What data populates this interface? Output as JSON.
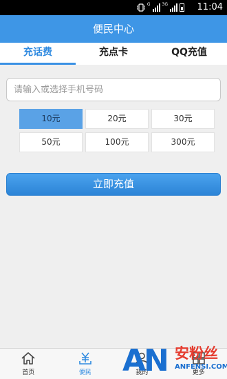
{
  "status_bar": {
    "time": "11:04",
    "net1": "G",
    "net2": "3G"
  },
  "header": {
    "title": "便民中心"
  },
  "tabs": [
    {
      "label": "充话费",
      "active": true
    },
    {
      "label": "充点卡",
      "active": false
    },
    {
      "label": "QQ充值",
      "active": false
    }
  ],
  "phone_input": {
    "placeholder": "请输入或选择手机号码",
    "value": ""
  },
  "amounts": [
    {
      "label": "10元",
      "selected": true
    },
    {
      "label": "20元",
      "selected": false
    },
    {
      "label": "30元",
      "selected": false
    },
    {
      "label": "50元",
      "selected": false
    },
    {
      "label": "100元",
      "selected": false
    },
    {
      "label": "300元",
      "selected": false
    }
  ],
  "recharge_button": {
    "label": "立即充值"
  },
  "bottom_nav": [
    {
      "label": "首页",
      "icon": "home-icon",
      "active": false
    },
    {
      "label": "便民",
      "icon": "yuan-icon",
      "active": true
    },
    {
      "label": "我的",
      "icon": "user-icon",
      "active": false
    },
    {
      "label": "更多",
      "icon": "more-icon",
      "active": false
    }
  ],
  "watermark": {
    "logo": "AN",
    "text": "安粉丝",
    "url": "ANFENSI.COM"
  },
  "colors": {
    "primary": "#3e96e6",
    "selected": "#5aa2e6",
    "accent_text": "#2f8ae0"
  }
}
